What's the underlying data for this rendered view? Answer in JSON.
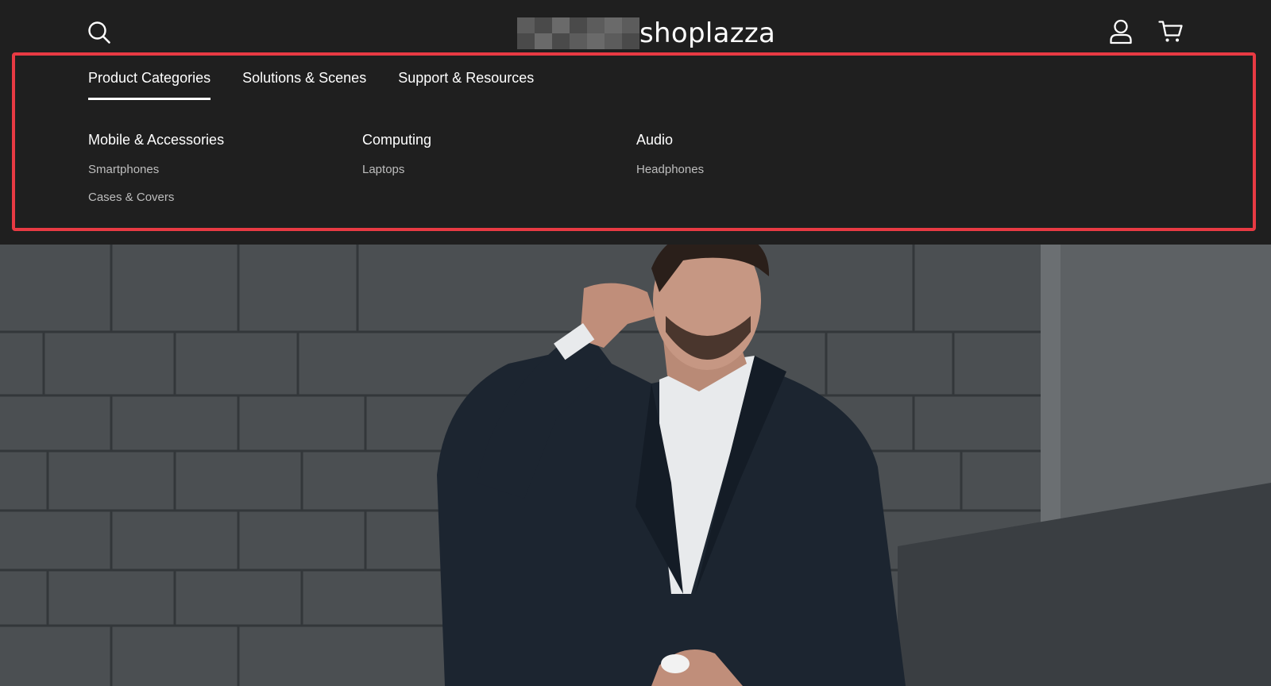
{
  "header": {
    "logo_text": "shoplazza",
    "icons": {
      "search": "search-icon",
      "account": "user-icon",
      "cart": "cart-icon"
    }
  },
  "menu": {
    "highlight_color": "#e83a43",
    "tabs": [
      {
        "label": "Product Categories",
        "active": true
      },
      {
        "label": "Solutions & Scenes",
        "active": false
      },
      {
        "label": "Support & Resources",
        "active": false
      }
    ],
    "columns": [
      {
        "title": "Mobile & Accessories",
        "links": [
          "Smartphones",
          "Cases & Covers"
        ]
      },
      {
        "title": "Computing",
        "links": [
          "Laptops"
        ]
      },
      {
        "title": "Audio",
        "links": [
          "Headphones"
        ]
      }
    ]
  },
  "hero": {
    "image": "man-in-suit-wearing-earbud-photo"
  }
}
